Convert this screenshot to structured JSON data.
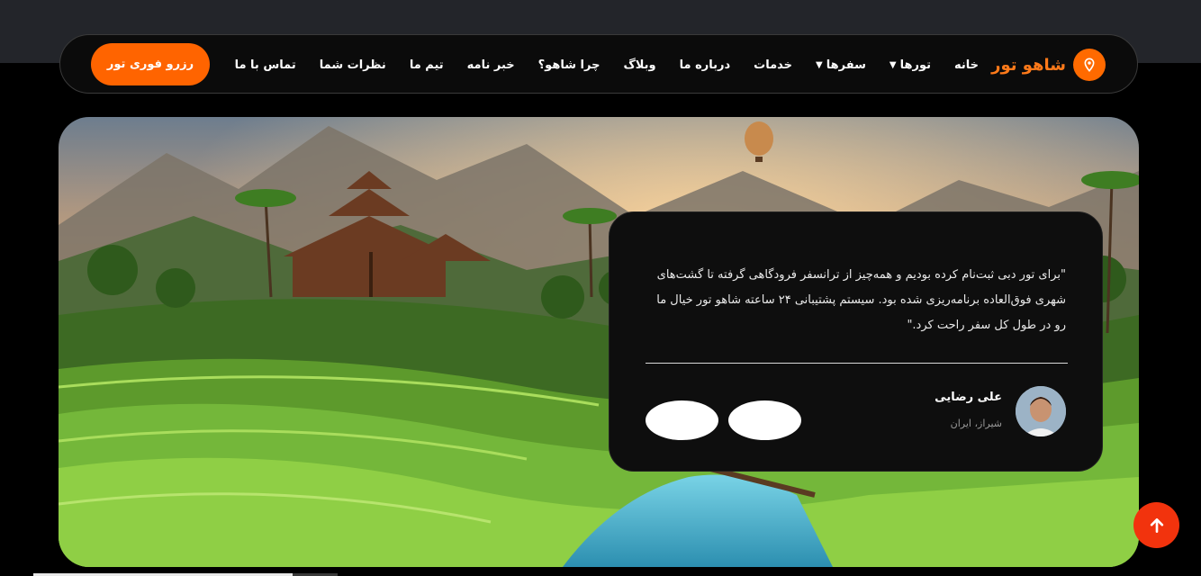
{
  "header": {
    "brand_name": "شاهو تور",
    "brand_icon": "location-pin-icon",
    "accent_color": "#ff6a00",
    "nav": [
      {
        "label": "خانه"
      },
      {
        "label": "تورها",
        "dropdown": true
      },
      {
        "label": "سفرها",
        "dropdown": true
      },
      {
        "label": "خدمات"
      },
      {
        "label": "درباره ما"
      },
      {
        "label": "وبلاگ"
      },
      {
        "label": "چرا شاهو؟"
      },
      {
        "label": "خبر نامه"
      },
      {
        "label": "تیم ما"
      },
      {
        "label": "نظرات شما"
      },
      {
        "label": "تماس با ما"
      }
    ],
    "cta_label": "رزرو فوری تور"
  },
  "testimonial": {
    "quote": "\"برای تور دبی ثبت‌نام کرده بودیم و همه‌چیز از ترانسفر فرودگاهی گرفته تا گشت‌های شهری فوق‌العاده برنامه‌ریزی شده بود. سیستم پشتیبانی ۲۴ ساعته شاهو تور خیال ما رو در طول کل سفر راحت کرد.\"",
    "author_name": "علی رضایی",
    "author_location": "شیراز، ایران"
  },
  "scroll_top_icon": "arrow-up-icon",
  "scroll_top_color": "#f2330d"
}
